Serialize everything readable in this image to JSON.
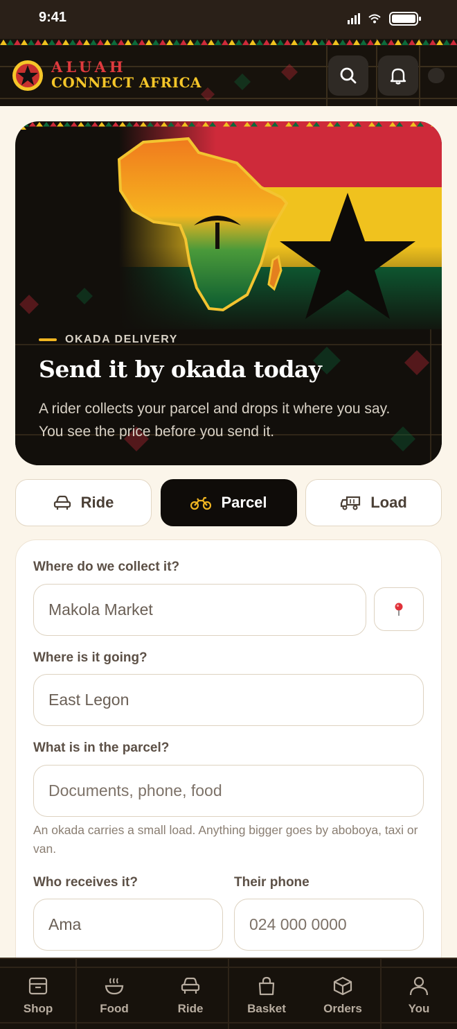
{
  "status_bar": {
    "time": "9:41"
  },
  "header": {
    "brand_top": "ALUAH",
    "brand_bottom": "CONNECT AFRICA",
    "search_icon": "search-icon",
    "bell_icon": "bell-icon"
  },
  "hero": {
    "eyebrow": "OKADA DELIVERY",
    "title": "Send it by okada today",
    "text": "A rider collects your parcel and drops it where you say. You see the price before you send it.",
    "flag_colors": [
      "#ce2a3a",
      "#f0c21e",
      "#0c6b3b",
      "#0a0806"
    ]
  },
  "modes": [
    {
      "label": "Ride",
      "icon": "car-icon",
      "active": false
    },
    {
      "label": "Parcel",
      "icon": "motorbike-icon",
      "active": true
    },
    {
      "label": "Load",
      "icon": "truck-icon",
      "active": false
    }
  ],
  "form": {
    "pickup_label": "Where do we collect it?",
    "pickup_value": "Makola Market",
    "pin_icon": "location-pin-icon",
    "dropoff_label": "Where is it going?",
    "dropoff_value": "East Legon",
    "contents_label": "What is in the parcel?",
    "contents_placeholder": "Documents, phone, food",
    "helper": "An okada carries a small load. Anything bigger goes by aboboya, taxi or van.",
    "receiver_label": "Who receives it?",
    "receiver_value": "Ama",
    "phone_label": "Their phone",
    "phone_placeholder": "024 000 0000"
  },
  "nav": [
    {
      "label": "Shop",
      "icon": "shop-icon"
    },
    {
      "label": "Food",
      "icon": "bowl-icon"
    },
    {
      "label": "Ride",
      "icon": "car-icon"
    },
    {
      "label": "Basket",
      "icon": "bag-icon"
    },
    {
      "label": "Orders",
      "icon": "box-icon"
    },
    {
      "label": "You",
      "icon": "person-icon"
    }
  ],
  "colors": {
    "accent": "#f5c629",
    "brand_red": "#e03a3e",
    "dark": "#17120c",
    "green": "#0c6b3b"
  }
}
